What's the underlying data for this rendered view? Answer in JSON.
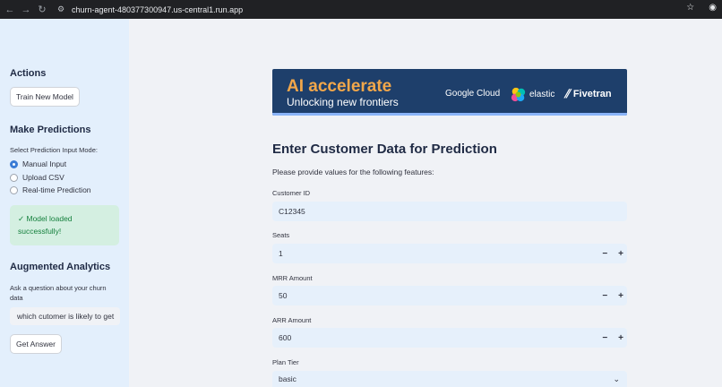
{
  "browser": {
    "url": "churn-agent-480377300947.us-central1.run.app",
    "back_icon": "←",
    "forward_icon": "→",
    "reload_icon": "↻",
    "site_info_icon": "⚙",
    "star_icon": "☆",
    "profile_icon": "◉"
  },
  "sidebar": {
    "actions_heading": "Actions",
    "train_button": "Train New Model",
    "predictions_heading": "Make Predictions",
    "mode_label": "Select Prediction Input Mode:",
    "modes": [
      "Manual Input",
      "Upload CSV",
      "Real-time Prediction"
    ],
    "selected_mode": "Manual Input",
    "success_line1": "✓ Model loaded",
    "success_line2": "successfully!",
    "analytics_heading": "Augmented Analytics",
    "question_label_line1": "Ask a question about your churn",
    "question_label_line2": "data",
    "question_value": "which cutomer is likely to get",
    "answer_button": "Get Answer"
  },
  "banner": {
    "title": "AI accelerate",
    "subtitle": "Unlocking new frontiers",
    "google_cloud": "Google Cloud",
    "elastic": "elastic",
    "fivetran": "Fivetran"
  },
  "main": {
    "title": "Enter Customer Data for Prediction",
    "intro": "Please provide values for the following features:",
    "fields": [
      {
        "label": "Customer ID",
        "value": "C12345"
      },
      {
        "label": "Seats",
        "value": "1"
      },
      {
        "label": "MRR Amount",
        "value": "50"
      },
      {
        "label": "ARR Amount",
        "value": "600"
      },
      {
        "label": "Plan Tier",
        "value": "basic"
      }
    ],
    "minus": "−",
    "plus": "+",
    "chevron": "⌄"
  },
  "colors": {
    "sidebar_bg": "#e3effc",
    "main_bg": "#f0f2f6",
    "banner_bg": "#1e3f6b",
    "accent": "#3a7bd5",
    "success_bg": "#d4efe1",
    "success_text": "#15803d"
  }
}
